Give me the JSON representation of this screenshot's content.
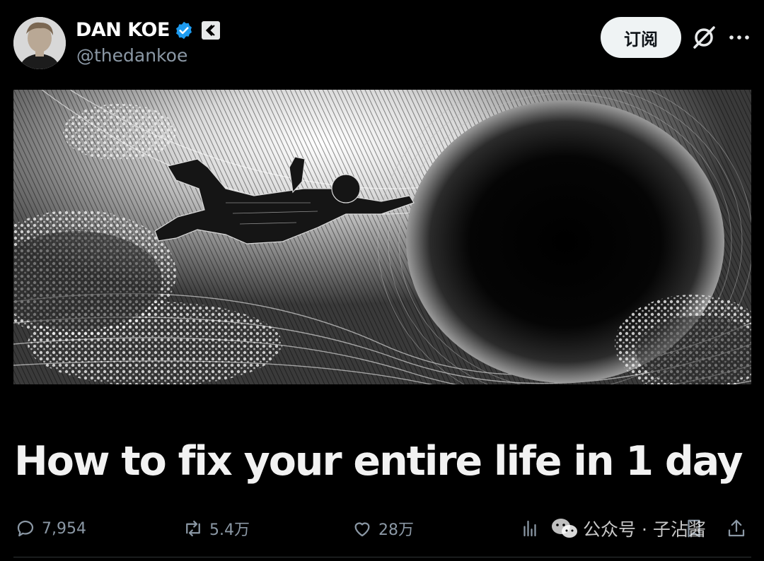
{
  "author": {
    "display_name": "DAN KOE",
    "handle": "@thedankoe"
  },
  "header": {
    "subscribe_label": "订阅"
  },
  "article": {
    "title": "How to fix your entire life in 1 day"
  },
  "metrics": {
    "replies": "7,954",
    "reposts": "5.4万",
    "likes": "28万"
  },
  "watermark": {
    "text": "公众号 · 子沾酱"
  },
  "icons": {
    "verified": "verified-badge-icon",
    "org": "affiliate-badge-icon",
    "grok": "grok-icon",
    "more": "more-icon",
    "reply": "reply-icon",
    "repost": "repost-icon",
    "like": "like-icon",
    "views": "views-icon",
    "bookmark": "bookmark-icon",
    "share": "share-icon"
  },
  "colors": {
    "background": "#000000",
    "verified": "#1d9bf0",
    "muted": "#8b98a5",
    "button_bg": "#eff3f4"
  }
}
